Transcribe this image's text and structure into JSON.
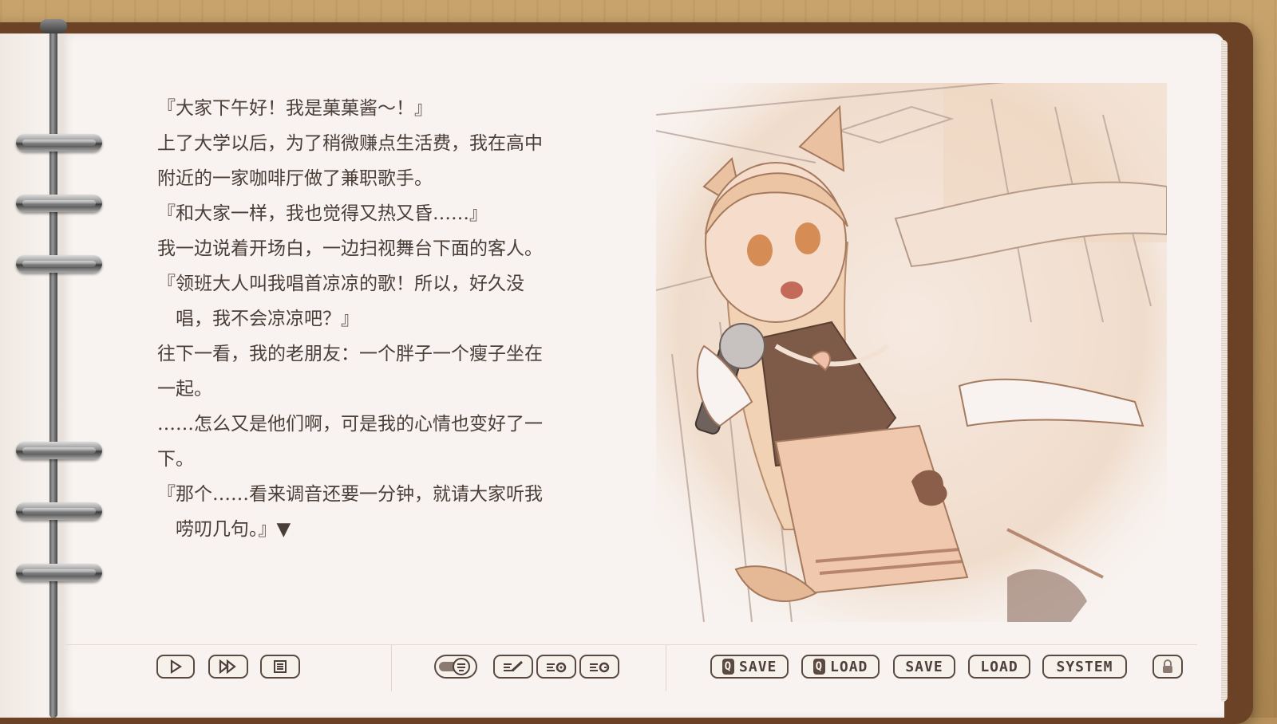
{
  "story": {
    "lines": [
      "『大家下午好！我是菓菓酱～！』",
      "上了大学以后，为了稍微赚点生活费，我在高中",
      "附近的一家咖啡厅做了兼职歌手。",
      "『和大家一样，我也觉得又热又昏……』",
      "我一边说着开场白，一边扫视舞台下面的客人。",
      "『领班大人叫我唱首凉凉的歌！所以，好久没",
      "　唱，我不会凉凉吧？』",
      "往下一看，我的老朋友：一个胖子一个瘦子坐在",
      "一起。",
      "……怎么又是他们啊，可是我的心情也变好了一",
      "下。",
      "『那个……看来调音还要一分钟，就请大家听我",
      "　唠叨几句。』▼"
    ]
  },
  "toolbar": {
    "qsave_prefix": "Q",
    "qsave_label": "SAVE",
    "qload_prefix": "Q",
    "qload_label": "LOAD",
    "save_label": "SAVE",
    "load_label": "LOAD",
    "system_label": "SYSTEM"
  },
  "icons": {
    "play": "play-icon",
    "skip": "fast-forward-icon",
    "log": "backlog-icon",
    "auto": "auto-toggle-icon",
    "edit": "edit-text-icon",
    "settings": "text-settings-icon",
    "voice": "voice-replay-icon",
    "lock": "lock-icon"
  },
  "colors": {
    "cover": "#6b4226",
    "paper": "#f8f3f0",
    "text": "#4a3e38",
    "button_border": "#5a4a42"
  }
}
